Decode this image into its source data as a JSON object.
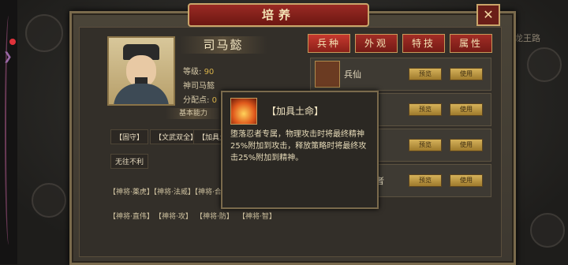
{
  "window": {
    "title": "培养",
    "close_icon": "close-icon"
  },
  "hero": {
    "name": "司马懿",
    "level_label": "等级:",
    "level_value": "90",
    "subtitle": "神司马懿",
    "points_label": "分配点:",
    "points_value": "0"
  },
  "abilities": {
    "tab_label": "基本能力",
    "tags_row1": [
      "【固守】",
      "【文武双全】",
      "【加具土"
    ],
    "tags_row2": [
      "无往不利"
    ],
    "tags_row3": [
      "【神将·薬虎】",
      "【神将·法威】",
      "【神将·合"
    ],
    "tags_row4": [
      "【神将·直伟】",
      "【神将·攻】",
      "【神将·防】",
      "【神将·智】"
    ]
  },
  "tabs": [
    {
      "label": "兵种",
      "active": true
    },
    {
      "label": "外观",
      "active": false
    },
    {
      "label": "特技",
      "active": false
    },
    {
      "label": "属性",
      "active": false
    }
  ],
  "skins": [
    {
      "name": "兵仙",
      "preview": "预览",
      "use": "使用"
    },
    {
      "name": "",
      "preview": "预览",
      "use": "使用"
    },
    {
      "name": "",
      "preview": "预览",
      "use": "使用"
    },
    {
      "name": "者",
      "preview": "预览",
      "use": "使用"
    }
  ],
  "tooltip": {
    "title": "【加具土命】",
    "description": "堕落忍者专属，物理攻击时将最终精神25%附加到攻击，释放策略时将最终攻击25%附加到精神。"
  },
  "background": {
    "side_text": "龙王路"
  },
  "colors": {
    "accent": "#8a2019",
    "gold": "#d8b24a"
  }
}
